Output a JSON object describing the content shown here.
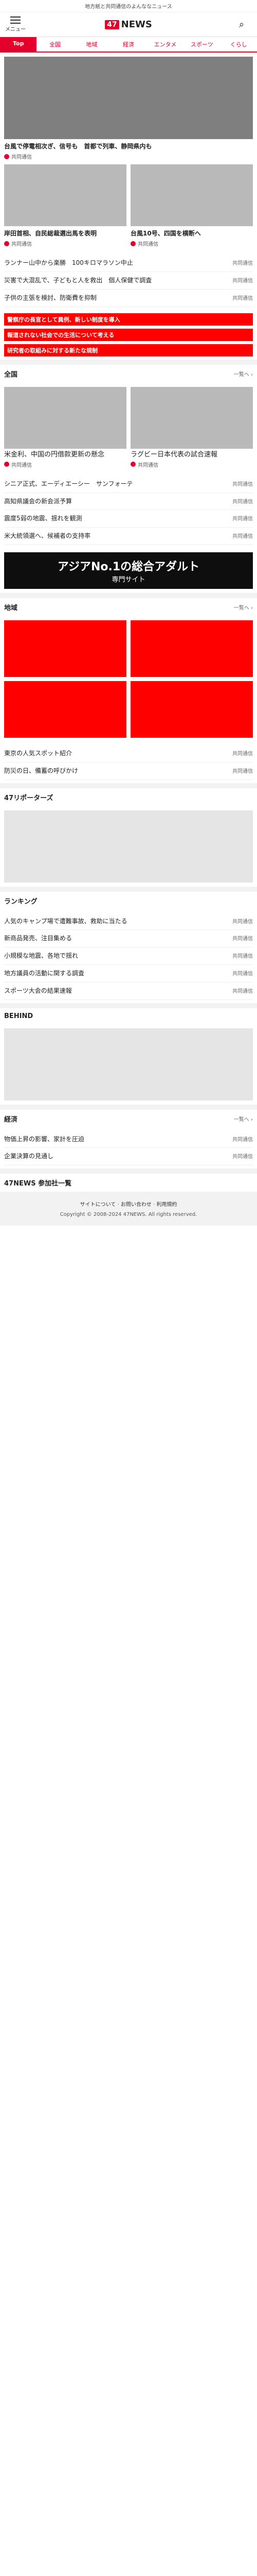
{
  "topline": "地方紙と共同通信のよんななニュース",
  "header": {
    "menu_label": "メニュー",
    "logo_mark": "47",
    "logo_text": "NEWS"
  },
  "tabs": [
    "Top",
    "全国",
    "地域",
    "経済",
    "エンタメ",
    "スポーツ",
    "くらし"
  ],
  "hero": [
    {
      "title": "台風で停電相次ぎ、信号も　首都で列車、静岡県内も",
      "source": "共同通信"
    },
    {
      "title": "岸田首相、自民総裁選出馬を表明",
      "source": "共同通信"
    },
    {
      "title": "台風10号、四国を横断へ",
      "source": "共同通信"
    }
  ],
  "top_list": [
    {
      "text": "ランナー山中から楽勝　100キロマラソン中止",
      "side": "共同通信"
    },
    {
      "text": "災害で大混乱で、子どもと人を救出　個人保健で調査",
      "side": "共同通信"
    },
    {
      "text": "子供の主張を検討、防衛費を抑制",
      "side": "共同通信"
    }
  ],
  "red_notes": [
    "警察庁の長官として異例、新しい制度を導入",
    "報道されない社会での生活について考える",
    "研究者の取組みに対する新たな規制"
  ],
  "sections": {
    "zenkoku": "全国",
    "chiiki": "地域",
    "bizarre": "47リポーターズ",
    "ranking": "ランキング",
    "bihind": "BEHIND",
    "keizai": "経済",
    "footer_news": "47NEWS 参加社一覧"
  },
  "zenkoku": [
    {
      "title": "米金利、中国の円借款更新の懸念",
      "source": "共同通信"
    },
    {
      "title": "ラグビー日本代表の試合速報",
      "source": "共同通信"
    }
  ],
  "zenkoku_list": [
    {
      "text": "シニア正式、エーディエーシー　サンフォーテ",
      "side": "共同通信"
    },
    {
      "text": "高知県議会の新会派予算",
      "side": "共同通信"
    },
    {
      "text": "震度5弱の地震、揺れを観測",
      "side": "共同通信"
    },
    {
      "text": "米大統領選へ、候補者の支持率",
      "side": "共同通信"
    }
  ],
  "ad": {
    "line1": "アジアNo.1の総合アダルト",
    "line2": "専門サイト"
  },
  "chiiki_list": [
    {
      "text": "東京の人気スポット紹介",
      "side": "共同通信"
    },
    {
      "text": "防災の日、備蓄の呼びかけ",
      "side": "共同通信"
    }
  ],
  "ranking": [
    {
      "text": "人気のキャンプ場で遭難事故、救助に当たる",
      "side": "共同通信"
    },
    {
      "text": "新商品発売、注目集める",
      "side": "共同通信"
    },
    {
      "text": "小規模な地震、各地で揺れ",
      "side": "共同通信"
    },
    {
      "text": "地方議員の活動に関する調査",
      "side": "共同通信"
    },
    {
      "text": "スポーツ大会の結果速報",
      "side": "共同通信"
    }
  ],
  "keizai_list": [
    {
      "text": "物価上昇の影響、家計を圧迫",
      "side": "共同通信"
    },
    {
      "text": "企業決算の見通し",
      "side": "共同通信"
    }
  ],
  "footer": {
    "links": [
      "サイトについて",
      "お問い合わせ",
      "利用規約"
    ],
    "copy": "Copyright © 2008-2024 47NEWS. All rights reserved."
  }
}
